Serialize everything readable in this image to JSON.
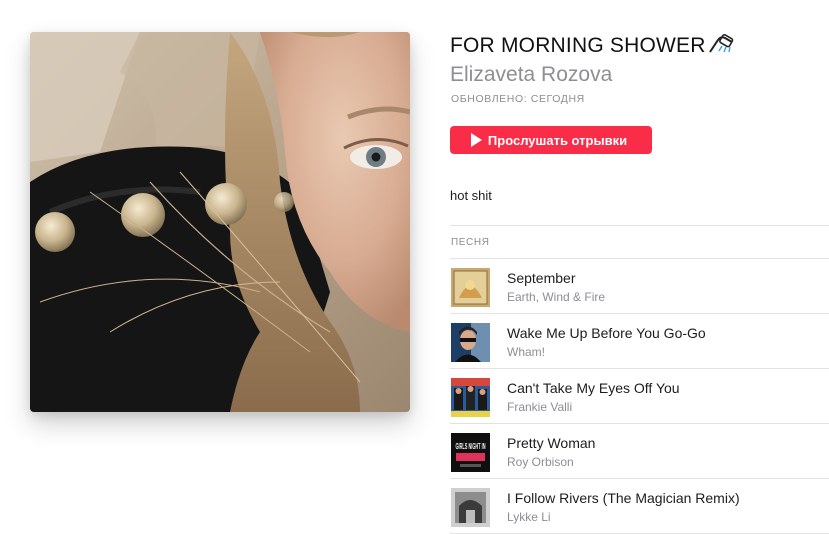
{
  "playlist": {
    "title": "FOR MORNING SHOWER",
    "title_emoji": "shower-emoji",
    "curator": "Elizaveta Rozova",
    "updated": "ОБНОВЛЕНО: СЕГОДНЯ",
    "description": "hot shit"
  },
  "actions": {
    "preview_label": "Прослушать отрывки",
    "accent_color": "#fa2d48"
  },
  "table": {
    "column_header": "ПЕСНЯ"
  },
  "tracks": [
    {
      "title": "September",
      "artist": "Earth, Wind & Fire"
    },
    {
      "title": "Wake Me Up Before You Go-Go",
      "artist": "Wham!"
    },
    {
      "title": "Can't Take My Eyes Off You",
      "artist": "Frankie Valli"
    },
    {
      "title": "Pretty Woman",
      "artist": "Roy Orbison",
      "art_text": "GIRLS NIGHT IN"
    },
    {
      "title": "I Follow Rivers (The Magician Remix)",
      "artist": "Lykke Li"
    }
  ]
}
